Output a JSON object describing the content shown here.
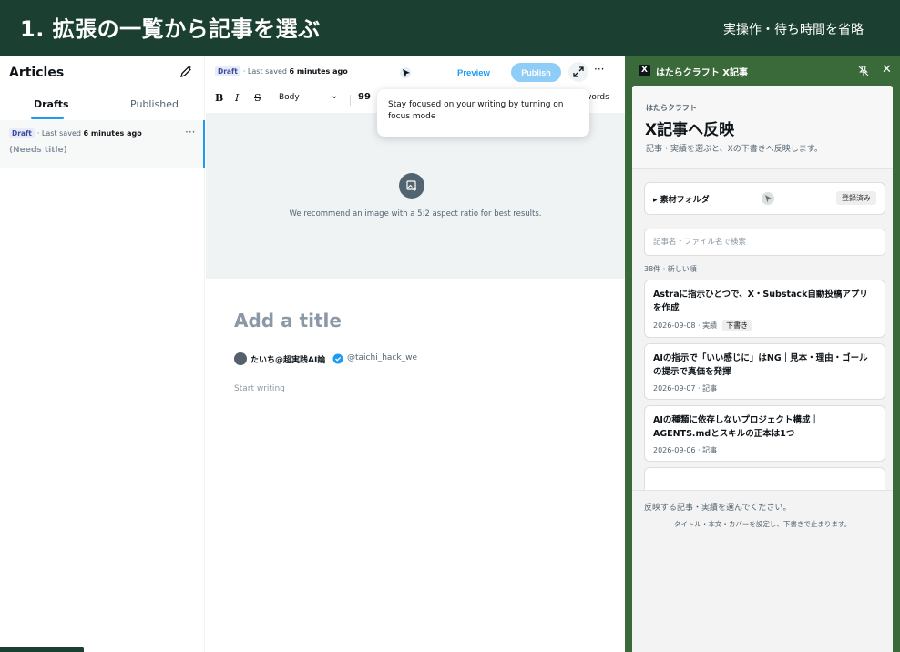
{
  "banner": {
    "title": "1. 拡張の一覧から記事を選ぶ",
    "note": "実操作・待ち時間を省略"
  },
  "articles": {
    "heading": "Articles",
    "tabs": [
      {
        "label": "Drafts",
        "active": true
      },
      {
        "label": "Published",
        "active": false
      }
    ],
    "draft": {
      "badge": "Draft",
      "saved_prefix": "· Last saved ",
      "saved_time": "6 minutes ago",
      "title": "(Needs title)",
      "more": "···"
    }
  },
  "editor": {
    "badge": "Draft",
    "saved_prefix": "· Last saved ",
    "saved_time": "6 minutes ago",
    "preview_label": "Preview",
    "publish_label": "Publish",
    "more": "···",
    "toolbar": {
      "bold": "B",
      "italic": "I",
      "strike": "S",
      "style_select": "Body",
      "quote": "99",
      "word_count": "words"
    },
    "tooltip": "Stay focused on your writing by turning on focus mode",
    "cover_hint": "We recommend an image with a 5:2 aspect ratio for best results.",
    "title_placeholder": "Add a title",
    "author_name": "たいち@超実践AI論",
    "author_handle": "@taichi_hack_we",
    "body_placeholder": "Start writing"
  },
  "panel": {
    "header_title": "はたらクラフト X記事",
    "x_logo": "X",
    "close": "✕",
    "eyebrow": "はたらクラフト",
    "title": "X記事へ反映",
    "description": "記事・実績を選ぶと、Xの下書きへ反映します。",
    "folder_label": "▸ 素材フォルダ",
    "folder_status": "登録済み",
    "search_placeholder": "記事名・ファイル名で検索",
    "count_label": "38件 · 新しい順",
    "cards": [
      {
        "title": "Astraに指示ひとつで、X・Substack自動投稿アプリを作成",
        "meta": "2026-09-08 · 実績",
        "tag": "下書き"
      },
      {
        "title": "AIの指示で「いい感じに」はNG｜見本・理由・ゴールの提示で真価を発揮",
        "meta": "2026-09-07 · 記事",
        "tag": ""
      },
      {
        "title": "AIの種類に依存しないプロジェクト構成｜AGENTS.mdとスキルの正本は1つ",
        "meta": "2026-09-06 · 記事",
        "tag": ""
      }
    ],
    "footer_message": "反映する記事・実績を選んでください。",
    "footer_note": "タイトル・本文・カバーを設定し、下書きで止まります。"
  },
  "colors": {
    "banner_bg": "#1b3f30",
    "panel_bg": "#3a6a3a",
    "accent_blue": "#1d9bf0",
    "publish_disabled": "#8ecdf8"
  },
  "icons": {
    "new_article": "compose-icon",
    "cursor": "cursor-icon",
    "expand": "expand-icon",
    "cover_upload": "image-add-icon",
    "verified": "verified-badge-icon",
    "pin": "pin-icon"
  }
}
